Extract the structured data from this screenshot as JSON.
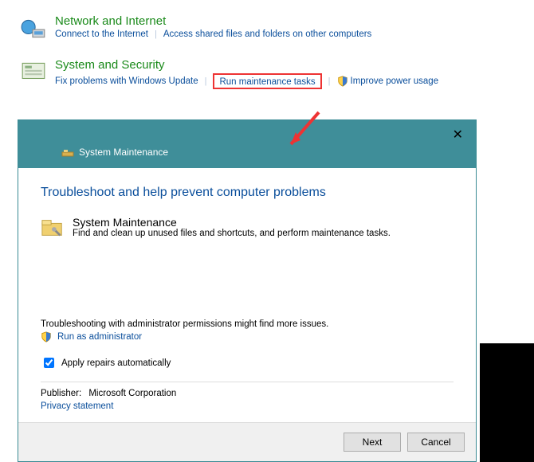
{
  "cp": {
    "network": {
      "title": "Network and Internet",
      "links": [
        "Connect to the Internet",
        "Access shared files and folders on other computers"
      ]
    },
    "system": {
      "title": "System and Security",
      "links": [
        "Fix problems with Windows Update",
        "Run maintenance tasks",
        "Improve power usage"
      ]
    }
  },
  "dialog": {
    "window_title": "System Maintenance",
    "heading": "Troubleshoot and help prevent computer problems",
    "item_title": "System Maintenance",
    "item_desc": "Find and clean up unused files and shortcuts, and perform maintenance tasks.",
    "admin_note": "Troubleshooting with administrator permissions might find more issues.",
    "admin_link": "Run as administrator",
    "apply_label": "Apply repairs automatically",
    "apply_checked": true,
    "publisher_label": "Publisher:",
    "publisher_value": "Microsoft Corporation",
    "privacy": "Privacy statement",
    "next": "Next",
    "cancel": "Cancel"
  }
}
